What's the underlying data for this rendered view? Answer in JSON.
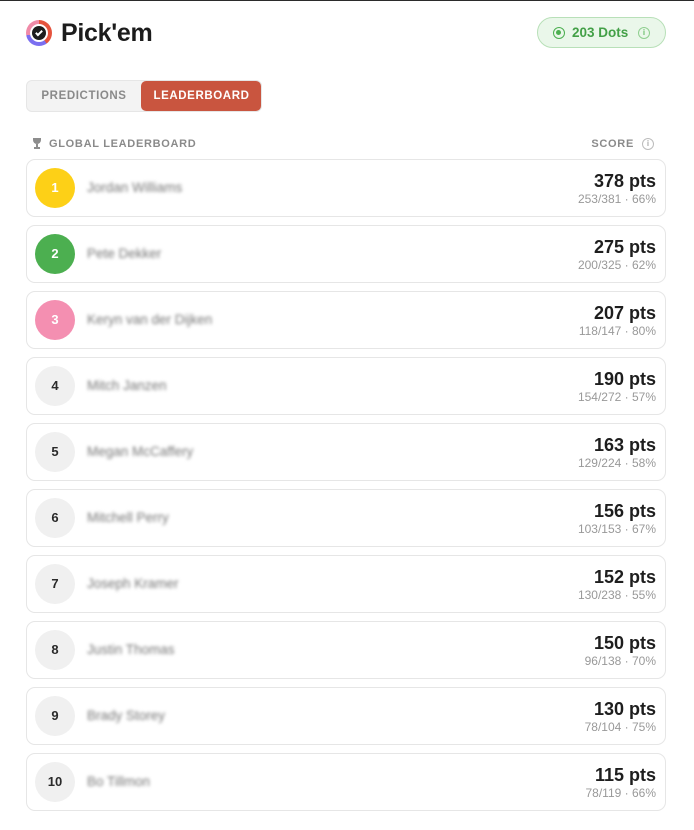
{
  "app": {
    "title": "Pick'em"
  },
  "balance": {
    "label": "203 Dots",
    "info": "i"
  },
  "tabs": [
    {
      "label": "PREDICTIONS",
      "active": false
    },
    {
      "label": "LEADERBOARD",
      "active": true
    }
  ],
  "leaderboard": {
    "title": "GLOBAL LEADERBOARD",
    "score_header": "SCORE",
    "score_info": "i",
    "rows": [
      {
        "rank": "1",
        "name": "Jordan Williams",
        "points": "378 pts",
        "detail": "253/381 · 66%"
      },
      {
        "rank": "2",
        "name": "Pete Dekker",
        "points": "275 pts",
        "detail": "200/325 · 62%"
      },
      {
        "rank": "3",
        "name": "Keryn van der Dijken",
        "points": "207 pts",
        "detail": "118/147 · 80%"
      },
      {
        "rank": "4",
        "name": "Mitch Janzen",
        "points": "190 pts",
        "detail": "154/272 · 57%"
      },
      {
        "rank": "5",
        "name": "Megan McCaffery",
        "points": "163 pts",
        "detail": "129/224 · 58%"
      },
      {
        "rank": "6",
        "name": "Mitchell Perry",
        "points": "156 pts",
        "detail": "103/153 · 67%"
      },
      {
        "rank": "7",
        "name": "Joseph Kramer",
        "points": "152 pts",
        "detail": "130/238 · 55%"
      },
      {
        "rank": "8",
        "name": "Justin Thomas",
        "points": "150 pts",
        "detail": "96/138 · 70%"
      },
      {
        "rank": "9",
        "name": "Brady Storey",
        "points": "130 pts",
        "detail": "78/104 · 75%"
      },
      {
        "rank": "10",
        "name": "Bo Tillmon",
        "points": "115 pts",
        "detail": "78/119 · 66%"
      }
    ]
  },
  "colors": {
    "accent": "#c9553f",
    "rank1": "#fdd017",
    "rank2": "#4caf50",
    "rank3": "#f48fb1",
    "dots_green": "#43a047"
  },
  "icons": {
    "logo": "pickem-logo-icon",
    "dots": "radio-dot-icon",
    "info": "info-icon",
    "trophy": "trophy-icon"
  }
}
